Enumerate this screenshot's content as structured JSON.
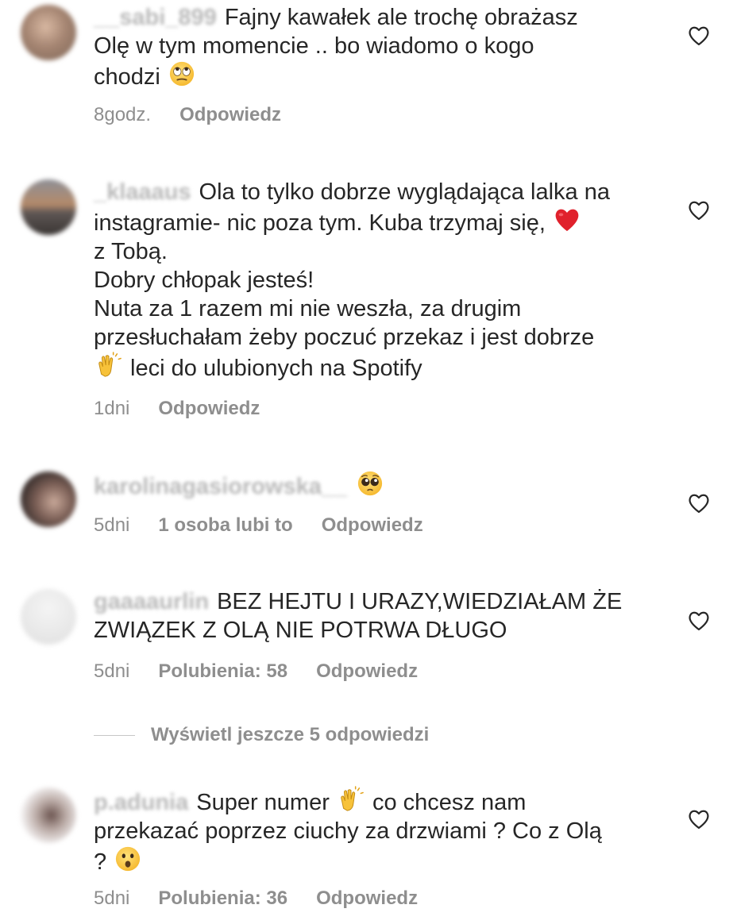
{
  "comments": [
    {
      "username": "__sabi_899",
      "text_parts": [
        "Fajny kawałek ale trochę obrażasz\nOlę w tym momencie .. bo wiadomo o kogo\nchodzi "
      ],
      "emoji": "eye-roll-emoji",
      "time": "8godz.",
      "likes": "",
      "reply": "Odpowiedz"
    },
    {
      "username": "_klaaaus",
      "text_parts": [
        "Ola to tylko dobrze wyglądająca lalka na\ninstagramie- nic poza tym. Kuba trzymaj się, ",
        "\nz Tobą.\nDobry chłopak jesteś!\nNuta za 1 razem mi nie weszła, za drugim\nprzesłuchałam żeby poczuć przekaz i jest dobrze\n",
        " leci do ulubionych na Spotify"
      ],
      "emoji": [
        "red-heart-emoji",
        "clapping-hands-emoji"
      ],
      "time": "1dni",
      "likes": "",
      "reply": "Odpowiedz"
    },
    {
      "username": "karolinagasiorowska__",
      "text_parts": [
        ""
      ],
      "emoji": "pleading-face-emoji",
      "time": "5dni",
      "likes": "1 osoba lubi to",
      "reply": "Odpowiedz"
    },
    {
      "username": "gaaaaurlin",
      "text_parts": [
        "BEZ HEJTU I URAZY,WIEDZIAŁAM ŻE\nZWIĄZEK Z OLĄ NIE POTRWA DŁUGO"
      ],
      "emoji": "",
      "time": "5dni",
      "likes": "Polubienia: 58",
      "reply": "Odpowiedz"
    },
    {
      "username": "p.adunia",
      "text_parts": [
        "Super numer ",
        " co chcesz nam\nprzekazać poprzez ciuchy za drzwiami ? Co z Olą\n? "
      ],
      "emoji": [
        "clapping-hands-emoji",
        "surprised-face-emoji"
      ],
      "time": "5dni",
      "likes": "Polubienia: 36",
      "reply": "Odpowiedz"
    }
  ],
  "view_more": "Wyświetl jeszcze 5 odpowiedzi",
  "icons": {
    "like": "heart-outline-icon"
  },
  "colors": {
    "text": "#262626",
    "meta": "#8e8e8e",
    "heart_emoji": "#e0212c",
    "emoji_face": "#ffcc3e"
  }
}
